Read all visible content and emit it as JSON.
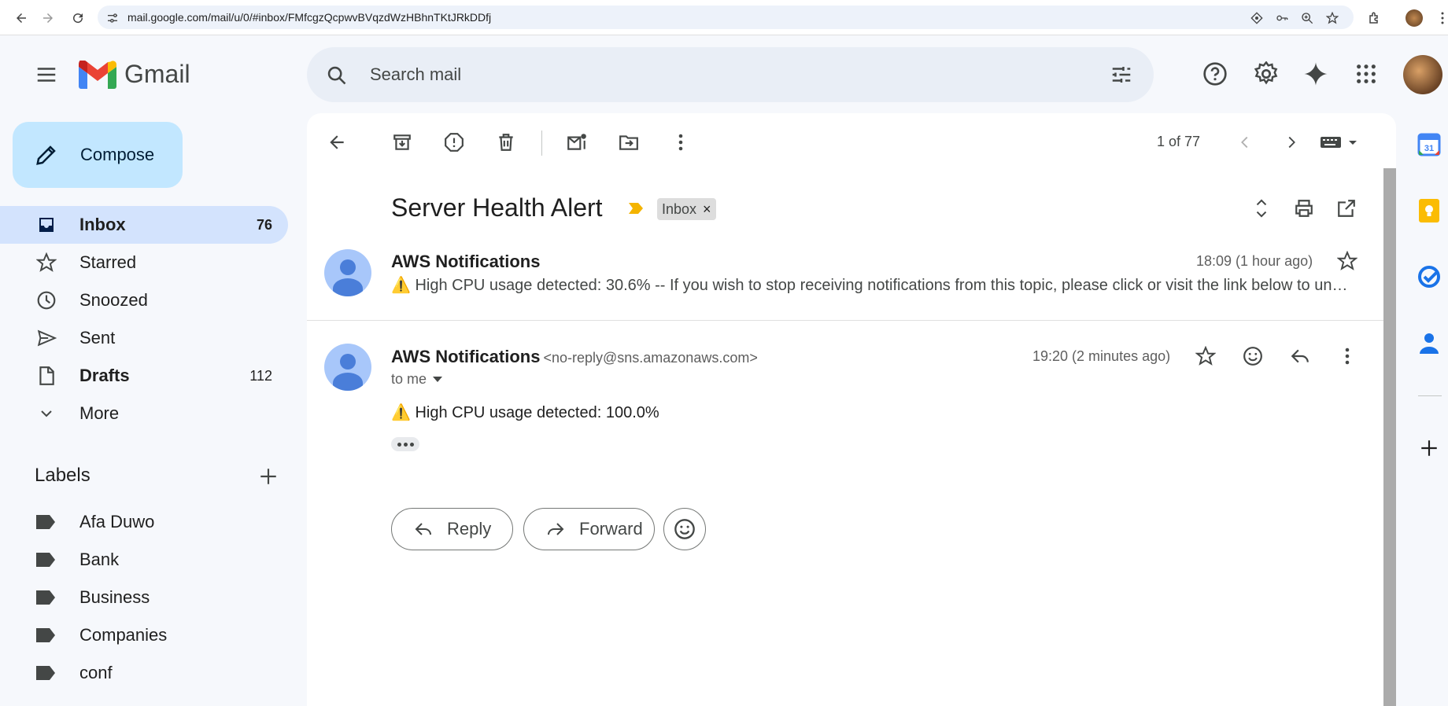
{
  "browser": {
    "url": "mail.google.com/mail/u/0/#inbox/FMfcgzQcpwvBVqzdWzHBhnTKtJRkDDfj"
  },
  "app": {
    "name": "Gmail"
  },
  "search": {
    "placeholder": "Search mail"
  },
  "sidebar": {
    "compose_label": "Compose",
    "items": [
      {
        "label": "Inbox",
        "count": "76",
        "icon": "inbox-icon"
      },
      {
        "label": "Starred",
        "count": "",
        "icon": "star-icon"
      },
      {
        "label": "Snoozed",
        "count": "",
        "icon": "clock-icon"
      },
      {
        "label": "Sent",
        "count": "",
        "icon": "send-icon"
      },
      {
        "label": "Drafts",
        "count": "112",
        "icon": "draft-icon"
      },
      {
        "label": "More",
        "count": "",
        "icon": "chevron-down-icon"
      }
    ],
    "labels_title": "Labels",
    "labels": [
      "Afa Duwo",
      "Bank",
      "Business",
      "Companies",
      "conf"
    ]
  },
  "toolbar": {
    "pager": "1 of 77"
  },
  "thread": {
    "subject": "Server Health Alert",
    "label_chip": "Inbox",
    "messages": [
      {
        "sender": "AWS Notifications",
        "time": "18:09 (1 hour ago)",
        "snippet": "⚠️ High CPU usage detected: 30.6% -- If you wish to stop receiving notifications from this topic, please click or visit the link below to unsubscribe:"
      },
      {
        "sender": "AWS Notifications",
        "email": "<no-reply@sns.amazonaws.com>",
        "recipient": "to me",
        "time": "19:20 (2 minutes ago)",
        "body": "⚠️ High CPU usage detected: 100.0%"
      }
    ],
    "reply_label": "Reply",
    "forward_label": "Forward"
  },
  "colors": {
    "accent": "#c2e7ff",
    "active_nav": "#d3e3fd",
    "avatar": "#a8c7fa"
  }
}
